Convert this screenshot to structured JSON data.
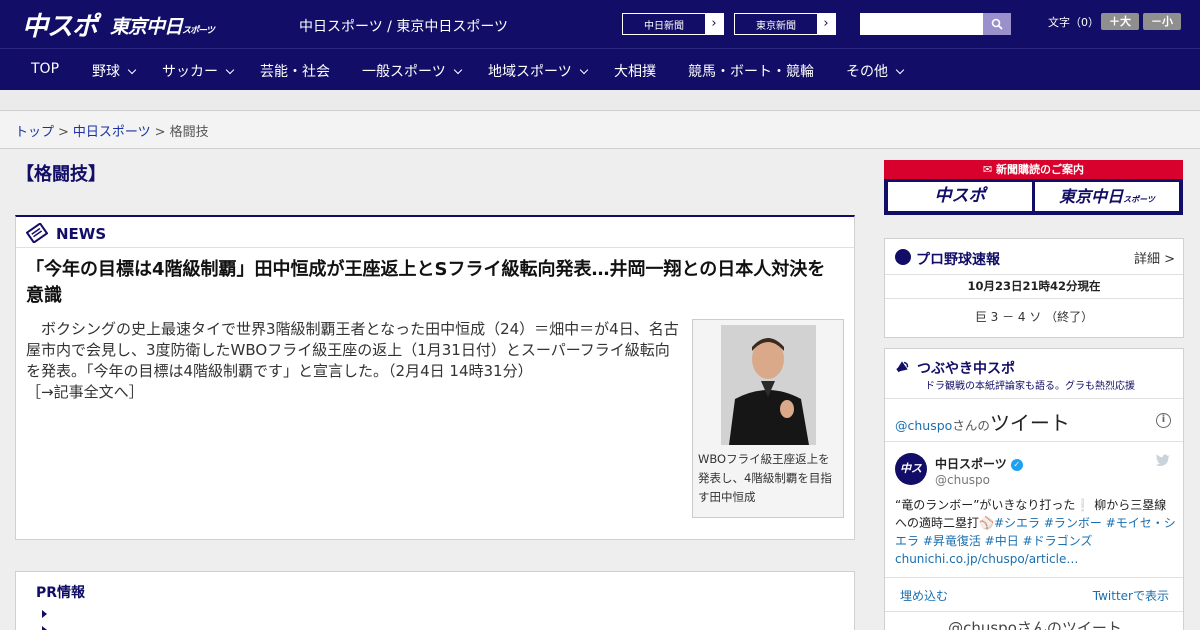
{
  "header": {
    "logo_main": "中スポ",
    "logo_tokyo": "東京中日",
    "logo_tokyo_small": "スポーツ",
    "site_name": "中日スポーツ / 東京中日スポーツ",
    "newspaper_buttons": [
      "中日新聞",
      "東京新聞"
    ],
    "search": {
      "placeholder": ""
    },
    "font_size_label": "文字（0）",
    "font_bigger": "＋大",
    "font_smaller": "－小"
  },
  "nav": {
    "items": [
      {
        "label": "TOP",
        "has_dropdown": false
      },
      {
        "label": "野球",
        "has_dropdown": true
      },
      {
        "label": "サッカー",
        "has_dropdown": true
      },
      {
        "label": "芸能・社会",
        "has_dropdown": false
      },
      {
        "label": "一般スポーツ",
        "has_dropdown": true
      },
      {
        "label": "地域スポーツ",
        "has_dropdown": true
      },
      {
        "label": "大相撲",
        "has_dropdown": false
      },
      {
        "label": "競馬・ボート・競輪",
        "has_dropdown": false
      },
      {
        "label": "その他",
        "has_dropdown": true
      }
    ]
  },
  "breadcrumb": {
    "home": "トップ",
    "section": "中日スポーツ",
    "current": "格闘技",
    "separator": ">"
  },
  "page_title": "【格闘技】",
  "news": {
    "section_label": "NEWS",
    "headline": "「今年の目標は4階級制覇」田中恒成が王座返上とSフライ級転向発表…井岡一翔との日本人対決を意識",
    "lead": "ボクシングの史上最速タイで世界3階級制覇王者となった田中恒成（24）＝畑中＝が4日、名古屋市内で会見し、3度防衛したWBOフライ級王座の返上（1月31日付）とスーパーフライ級転向を発表。「今年の目標は4階級制覇です」と宣言した。（2月4日 14時31分）",
    "read_more": "［→記事全文へ］",
    "photo_caption": "WBOフライ級王座返上を発表し、4階級制覇を目指す田中恒成"
  },
  "pr": {
    "title": "PR情報"
  },
  "sidebar": {
    "subscribe": {
      "header": "新聞購読のご案内",
      "logo_1": "中スポ",
      "logo_2": "東京中日",
      "logo_2_small": "スポーツ"
    },
    "baseball": {
      "title": "プロ野球速報",
      "detail_link": "詳細 >",
      "timestamp": "10月23日21時42分現在",
      "score": "巨 3 － 4 ソ （終了）"
    },
    "tweets": {
      "title": "つぶやき中スポ",
      "subtitle": "ドラ観戦の本紙評論家も語る。グラも熱烈応援",
      "byline_handle": "@chuspo",
      "byline_mid": "さんの",
      "byline_big": "ツイート",
      "author_name": "中日スポーツ",
      "author_handle": "@chuspo",
      "avatar_text": "中ス",
      "tweet_text": "“竜のランボー”がいきなり打った❕ 柳から三塁線への適時二塁打⚾",
      "tweet_tags": "#シエラ #ランボー #モイセ・シエラ #昇竜復活 #中日 #ドラゴンズ",
      "tweet_link": "chunichi.co.jp/chuspo/article…",
      "embed_link": "埋め込む",
      "view_on_twitter": "Twitterで表示",
      "more_tweets": "@chuspoさんのツイート"
    }
  },
  "colors": {
    "brand_navy": "#120d66",
    "subscribe_red": "#d8002c",
    "link_blue": "#1a33a3",
    "twitter_blue": "#1da1f2"
  }
}
